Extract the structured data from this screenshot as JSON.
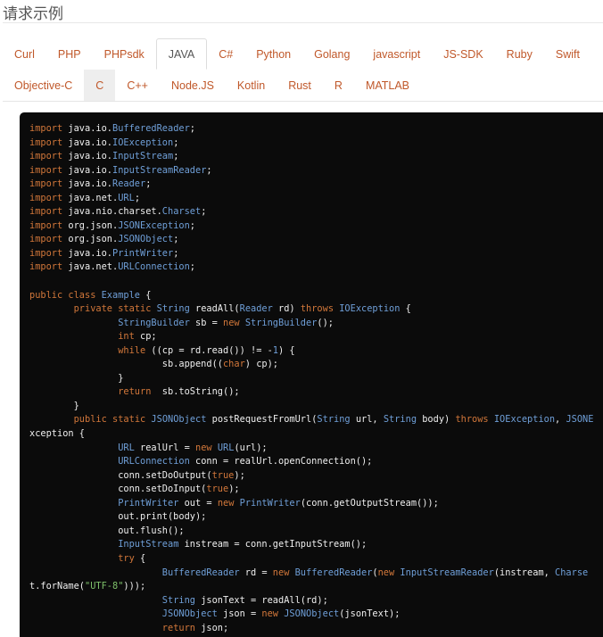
{
  "title": "请求示例",
  "tabs_row1": [
    "Curl",
    "PHP",
    "PHPsdk",
    "JAVA",
    "C#",
    "Python",
    "Golang",
    "javascript",
    "JS-SDK",
    "Ruby",
    "Swift"
  ],
  "tabs_row2": [
    "Objective-C",
    "C",
    "C++",
    "Node.JS",
    "Kotlin",
    "Rust",
    "R",
    "MATLAB"
  ],
  "active_tab": "JAVA",
  "selected_tab": "C",
  "colors": {
    "tab_link": "#c0582a",
    "keyword": "#d2773a",
    "type": "#6f9fd8",
    "string": "#7ec06a",
    "code_bg": "#0b0b0b"
  },
  "code_lines": [
    "import java.io.BufferedReader;",
    "import java.io.IOException;",
    "import java.io.InputStream;",
    "import java.io.InputStreamReader;",
    "import java.io.Reader;",
    "import java.net.URL;",
    "import java.nio.charset.Charset;",
    "import org.json.JSONException;",
    "import org.json.JSONObject;",
    "import java.io.PrintWriter;",
    "import java.net.URLConnection;",
    "",
    "public class Example {",
    "        private static String readAll(Reader rd) throws IOException {",
    "                StringBuilder sb = new StringBuilder();",
    "                int cp;",
    "                while ((cp = rd.read()) != -1) {",
    "                        sb.append((char) cp);",
    "                }",
    "                return  sb.toString();",
    "        }",
    "        public static JSONObject postRequestFromUrl(String url, String body) throws IOException, JSONE",
    "xception {",
    "                URL realUrl = new URL(url);",
    "                URLConnection conn = realUrl.openConnection();",
    "                conn.setDoOutput(true);",
    "                conn.setDoInput(true);",
    "                PrintWriter out = new PrintWriter(conn.getOutputStream());",
    "                out.print(body);",
    "                out.flush();",
    "                InputStream instream = conn.getInputStream();",
    "                try {",
    "                        BufferedReader rd = new BufferedReader(new InputStreamReader(instream, Charse",
    "t.forName(\"UTF-8\")));",
    "                        String jsonText = readAll(rd);",
    "                        JSONObject json = new JSONObject(jsonText);",
    "                        return json;"
  ]
}
